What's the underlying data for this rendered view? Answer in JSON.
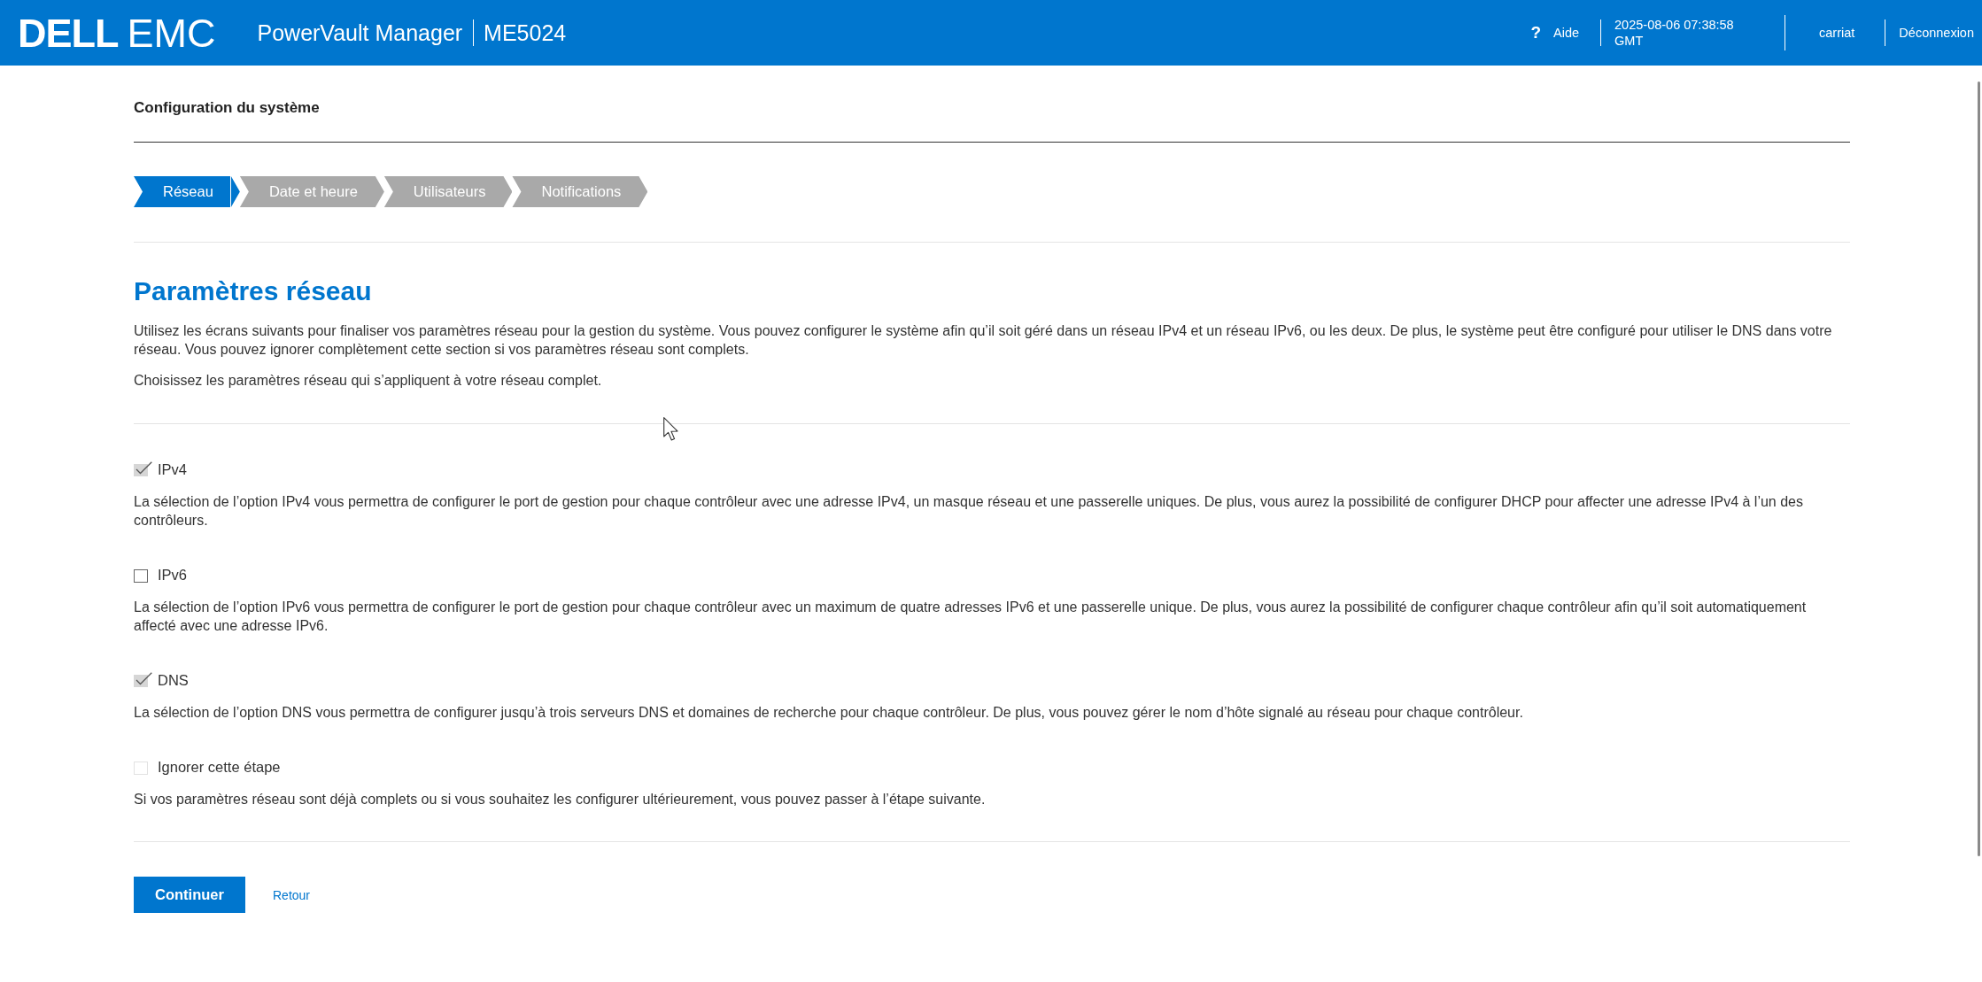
{
  "header": {
    "logo": {
      "wordmark": "DELL",
      "suffix": "EMC"
    },
    "app_title": "PowerVault Manager",
    "model": "ME5024",
    "help": {
      "icon": "?",
      "label": "Aide"
    },
    "clock": {
      "datetime": "2025-08-06 07:38:58",
      "timezone": "GMT"
    },
    "user": "carriat",
    "logout": "Déconnexion"
  },
  "page_title": "Configuration du système",
  "steps": [
    {
      "label": "Réseau",
      "selected": true
    },
    {
      "label": "Date et heure",
      "selected": false
    },
    {
      "label": "Utilisateurs",
      "selected": false
    },
    {
      "label": "Notifications",
      "selected": false
    }
  ],
  "section": {
    "heading": "Paramètres réseau",
    "intro": [
      "Utilisez les écrans suivants pour finaliser vos paramètres réseau pour la gestion du système. Vous pouvez configurer le système afin qu’il soit géré dans un réseau IPv4 et un réseau IPv6, ou les deux. De plus, le système peut être configuré pour utiliser le DNS dans votre réseau. Vous pouvez ignorer complètement cette section si vos paramètres réseau sont complets.",
      "Choisissez les paramètres réseau qui s’appliquent à votre réseau complet."
    ]
  },
  "options": [
    {
      "label": "IPv4",
      "checked": true,
      "disabled": false,
      "description": "La sélection de l’option IPv4 vous permettra de configurer le port de gestion pour chaque contrôleur avec une adresse IPv4, un masque réseau et une passerelle uniques. De plus, vous aurez la possibilité de configurer DHCP pour affecter une adresse IPv4 à l’un des contrôleurs."
    },
    {
      "label": "IPv6",
      "checked": false,
      "disabled": false,
      "description": "La sélection de l’option IPv6 vous permettra de configurer le port de gestion pour chaque contrôleur avec un maximum de quatre adresses IPv6 et une passerelle unique. De plus, vous aurez la possibilité de configurer chaque contrôleur afin qu’il soit automatiquement affecté avec une adresse IPv6."
    },
    {
      "label": "DNS",
      "checked": true,
      "disabled": false,
      "description": "La sélection de l’option DNS vous permettra de configurer jusqu’à trois serveurs DNS et domaines de recherche pour chaque contrôleur. De plus, vous pouvez gérer le nom d’hôte signalé au réseau pour chaque contrôleur."
    },
    {
      "label": "Ignorer cette étape",
      "checked": false,
      "disabled": true,
      "description": "Si vos paramètres réseau sont déjà complets ou si vous souhaitez les configurer ultérieurement, vous pouvez passer à l’étape suivante."
    }
  ],
  "actions": {
    "primary": "Continuer",
    "secondary": "Retour"
  }
}
